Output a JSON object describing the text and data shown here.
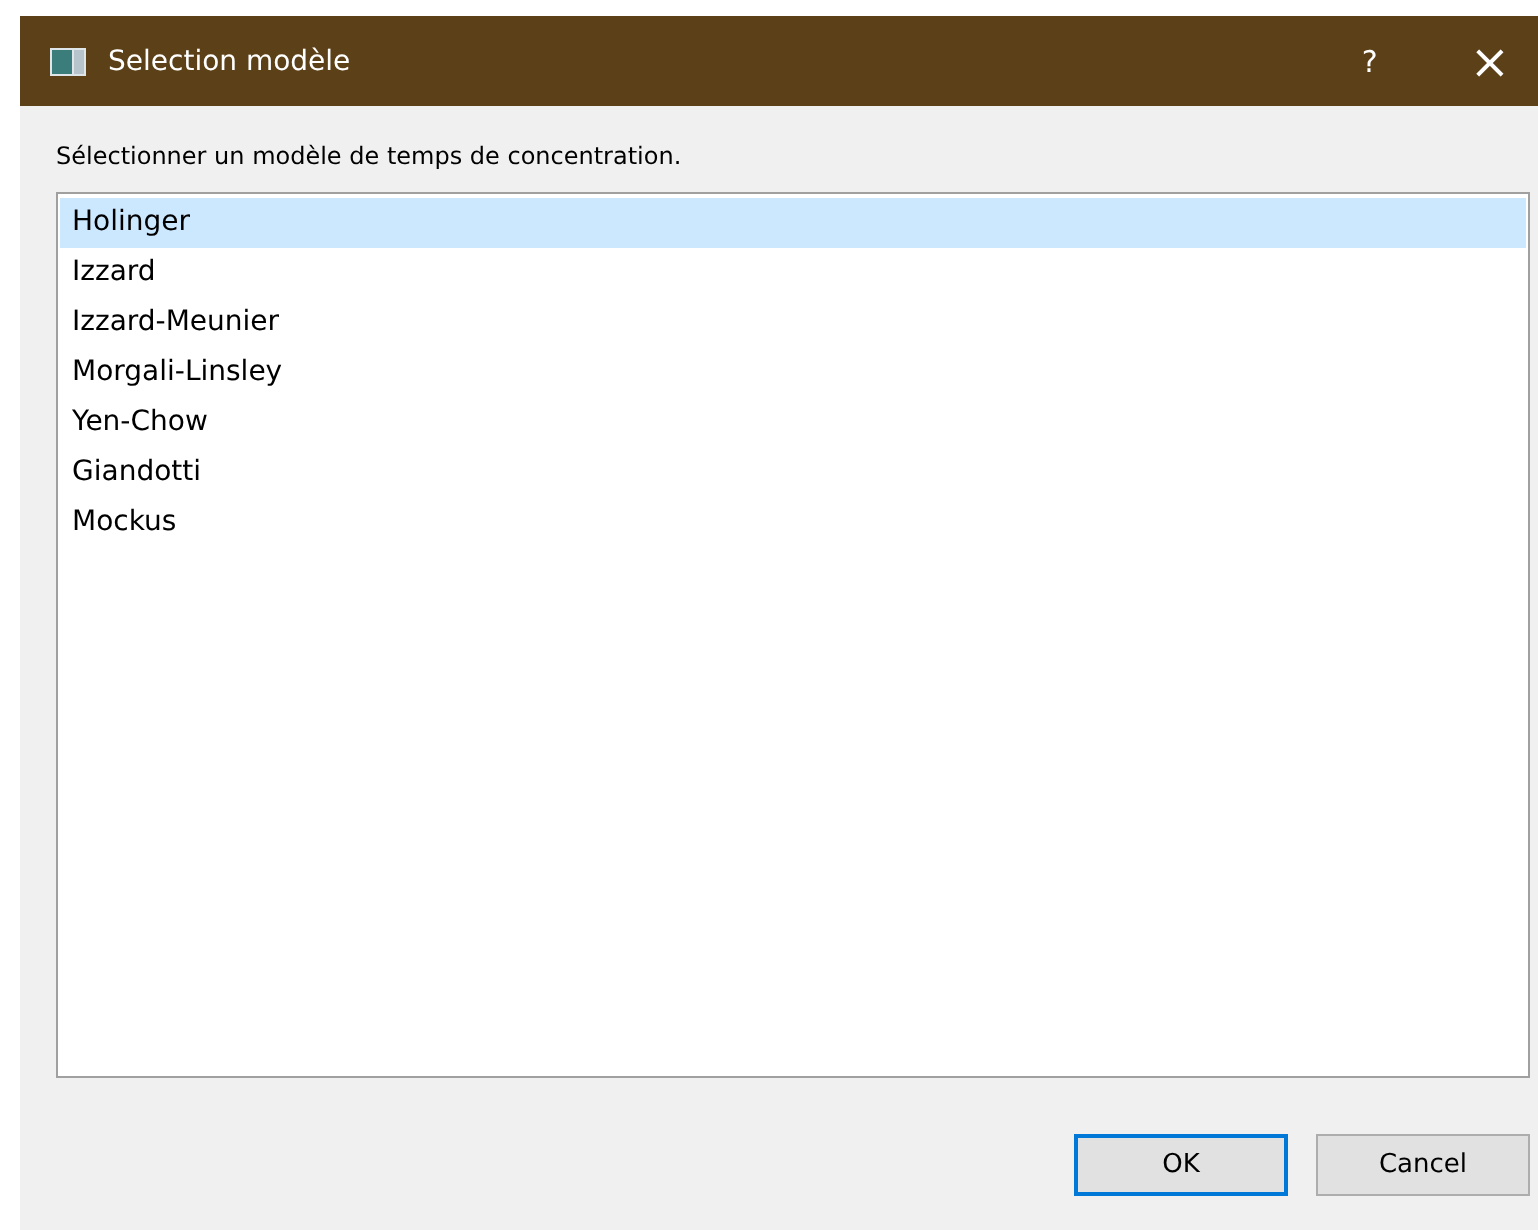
{
  "window": {
    "title": "Selection modèle",
    "help": "?",
    "close": "×"
  },
  "prompt": "Sélectionner un modèle de temps de concentration.",
  "list": {
    "items": [
      {
        "label": "Holinger",
        "selected": true
      },
      {
        "label": "Izzard",
        "selected": false
      },
      {
        "label": "Izzard-Meunier",
        "selected": false
      },
      {
        "label": "Morgali-Linsley",
        "selected": false
      },
      {
        "label": "Yen-Chow",
        "selected": false
      },
      {
        "label": "Giandotti",
        "selected": false
      },
      {
        "label": "Mockus",
        "selected": false
      }
    ]
  },
  "buttons": [
    {
      "label": "OK",
      "default": true
    },
    {
      "label": "Cancel",
      "default": false
    }
  ]
}
